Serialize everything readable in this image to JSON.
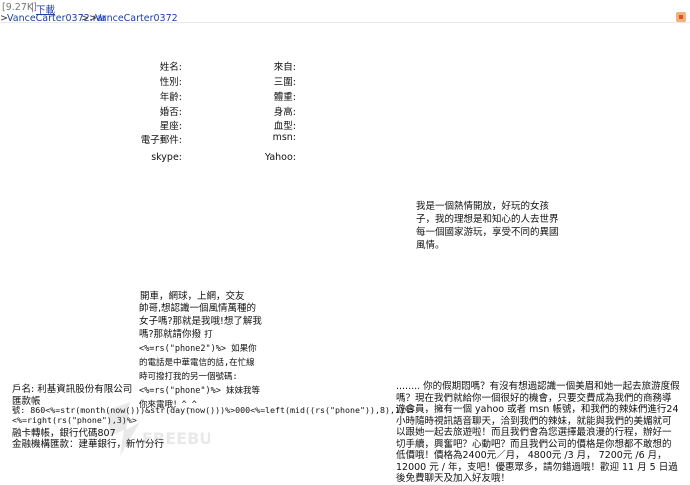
{
  "header": {
    "size": "[9.27K]",
    "download": "下載",
    "breadcrumb_prefix": ">",
    "crumb1": "VanceCarter0372.rar",
    "crumb_sep": ">>",
    "crumb2": "VanceCarter0372"
  },
  "profile_left": {
    "name": "姓名:",
    "gender": "性別:",
    "age": "年齡:",
    "marital": "婚否:",
    "zodiac": "星座:",
    "email": "電子郵件:",
    "skype": "skype:"
  },
  "profile_right": {
    "from": "來自:",
    "bust": "三圍:",
    "weight": "體重:",
    "height": "身高:",
    "blood": "血型:",
    "msn": "msn:",
    "yahoo": "Yahoo:"
  },
  "intro": "我是一個熱情開放，好玩的女孩子，我的理想是和知心的人去世界每一個國家游玩，享受不同的異國風情。",
  "hobbies": "開車，網球，上網，交友",
  "message": {
    "line1": "帥哥,想認識一個風情萬種的女子嗎?那就是我哦!想了解我嗎?那就請你撥",
    "line2": "打<%=rs(\"phone2\")%> 如果你的電話是中華電信的話,在忙線時可撥打我的另一個號碼:",
    "line3": "<%=rs(\"phone\")%> 妹妹我等你來電哦！^_^"
  },
  "bank": {
    "account_name": "戶名: 利基資訊股份有限公司",
    "remit_label": "匯款帳",
    "code_line1": "號: 860<%=str(month(now()))&str(day(now()))%>000<%=left(mid((rs(\"phone\")),8),1)%>",
    "code_line2": "<%=right(rs(\"phone\"),3)%>",
    "atm": "融卡轉帳，銀行代碼807",
    "bank_note": "金融機構匯款：建華銀行，新竹分行"
  },
  "promo": "........ 你的假期悶嗎？有沒有想過認識一個美眉和她一起去旅游度假嗎？現在我們就給你一個很好的機會，只要交費成為我們的商務導遊會員，擁有一個 yahoo 或者 msn 帳號，和我們的辣妹們進行24小時隨時視訊語音聊天，洽到我們的辣妹，就能與我們的美媚就可以跟她一起去旅遊啦！而且我們會為您選擇最浪漫的行程，辦好一切手續，興奮吧？心動吧？而且我們公司的價格是你想都不敢想的低價哦！價格為2400元／月， 4800元 /3 月， 7200元 /6 月， 12000 元 / 年，支吧！優惠眾多，請勿錯過哦！歡迎 11 月 5 日過後免費聊天及加入好友哦！",
  "watermark": "FREEBUF",
  "colors": {
    "link": "#1a3fa8",
    "accent": "#e05030"
  }
}
